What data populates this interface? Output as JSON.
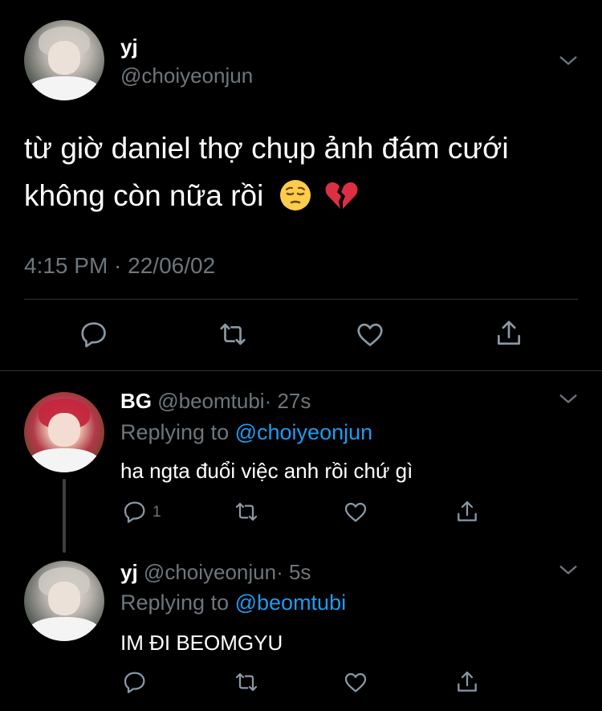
{
  "main_tweet": {
    "display_name": "yj",
    "handle": "@choiyeonjun",
    "text_line1": "từ giờ daniel thợ chụp ảnh đám cưới",
    "text_line2": "không còn nữa rồi",
    "emojis": [
      "pensive-face",
      "broken-heart"
    ],
    "timestamp": "4:15 PM · 22/06/02"
  },
  "replies": [
    {
      "display_name": "BG",
      "handle": "@beomtubi",
      "time": "· 27s",
      "replying_prefix": "Replying to",
      "replying_to": "@choiyeonjun",
      "text": "ha ngta đuổi việc anh rồi chứ gì",
      "reply_count": "1"
    },
    {
      "display_name": "yj",
      "handle": "@choiyeonjun",
      "time": "· 5s",
      "replying_prefix": "Replying to",
      "replying_to": "@beomtubi",
      "text": "IM ĐI BEOMGYU"
    }
  ],
  "colors": {
    "background": "#000000",
    "text": "#ffffff",
    "secondary": "#6e767d",
    "link": "#1d9bf0",
    "icon": "#8b98a5"
  }
}
